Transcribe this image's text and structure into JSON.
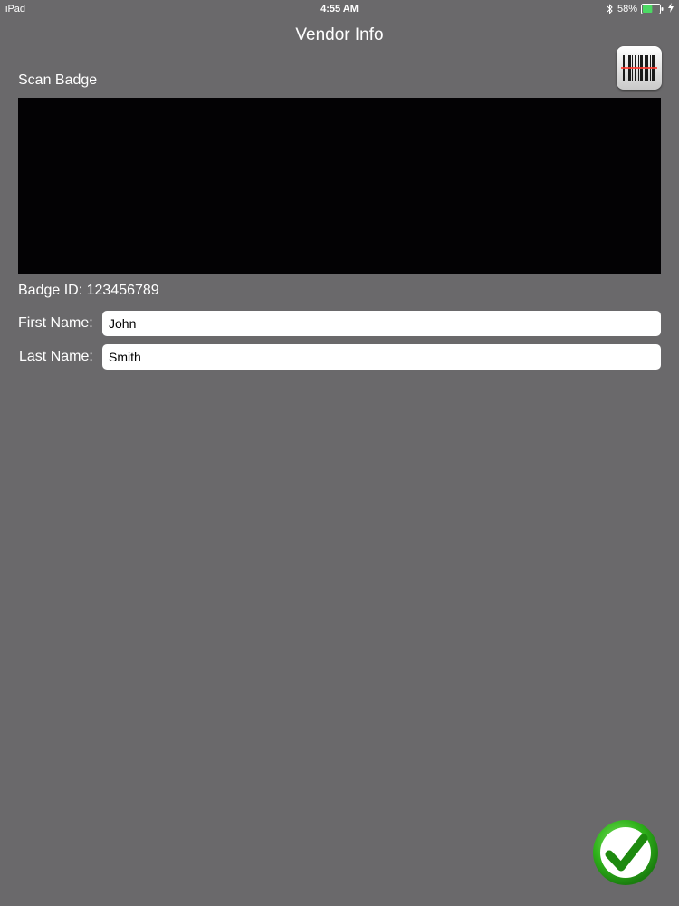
{
  "status_bar": {
    "device": "iPad",
    "time": "4:55 AM",
    "battery_percent": "58%",
    "battery_level": 0.58,
    "icons": [
      "bluetooth-icon",
      "battery-icon",
      "charging-icon"
    ]
  },
  "nav": {
    "title": "Vendor Info"
  },
  "scanner": {
    "label": "Scan Badge",
    "button_icon": "barcode-scanner-icon"
  },
  "badge": {
    "id_text": "Badge ID: 123456789"
  },
  "form": {
    "first_name_label": "First Name:",
    "first_name_value": "John",
    "last_name_label": "Last Name:",
    "last_name_value": "Smith"
  },
  "confirm": {
    "icon": "checkmark-icon"
  },
  "colors": {
    "background": "#6a696b",
    "camera_preview": "#030204",
    "confirm_green": "#2fb21b",
    "battery_green": "#4cd964"
  }
}
